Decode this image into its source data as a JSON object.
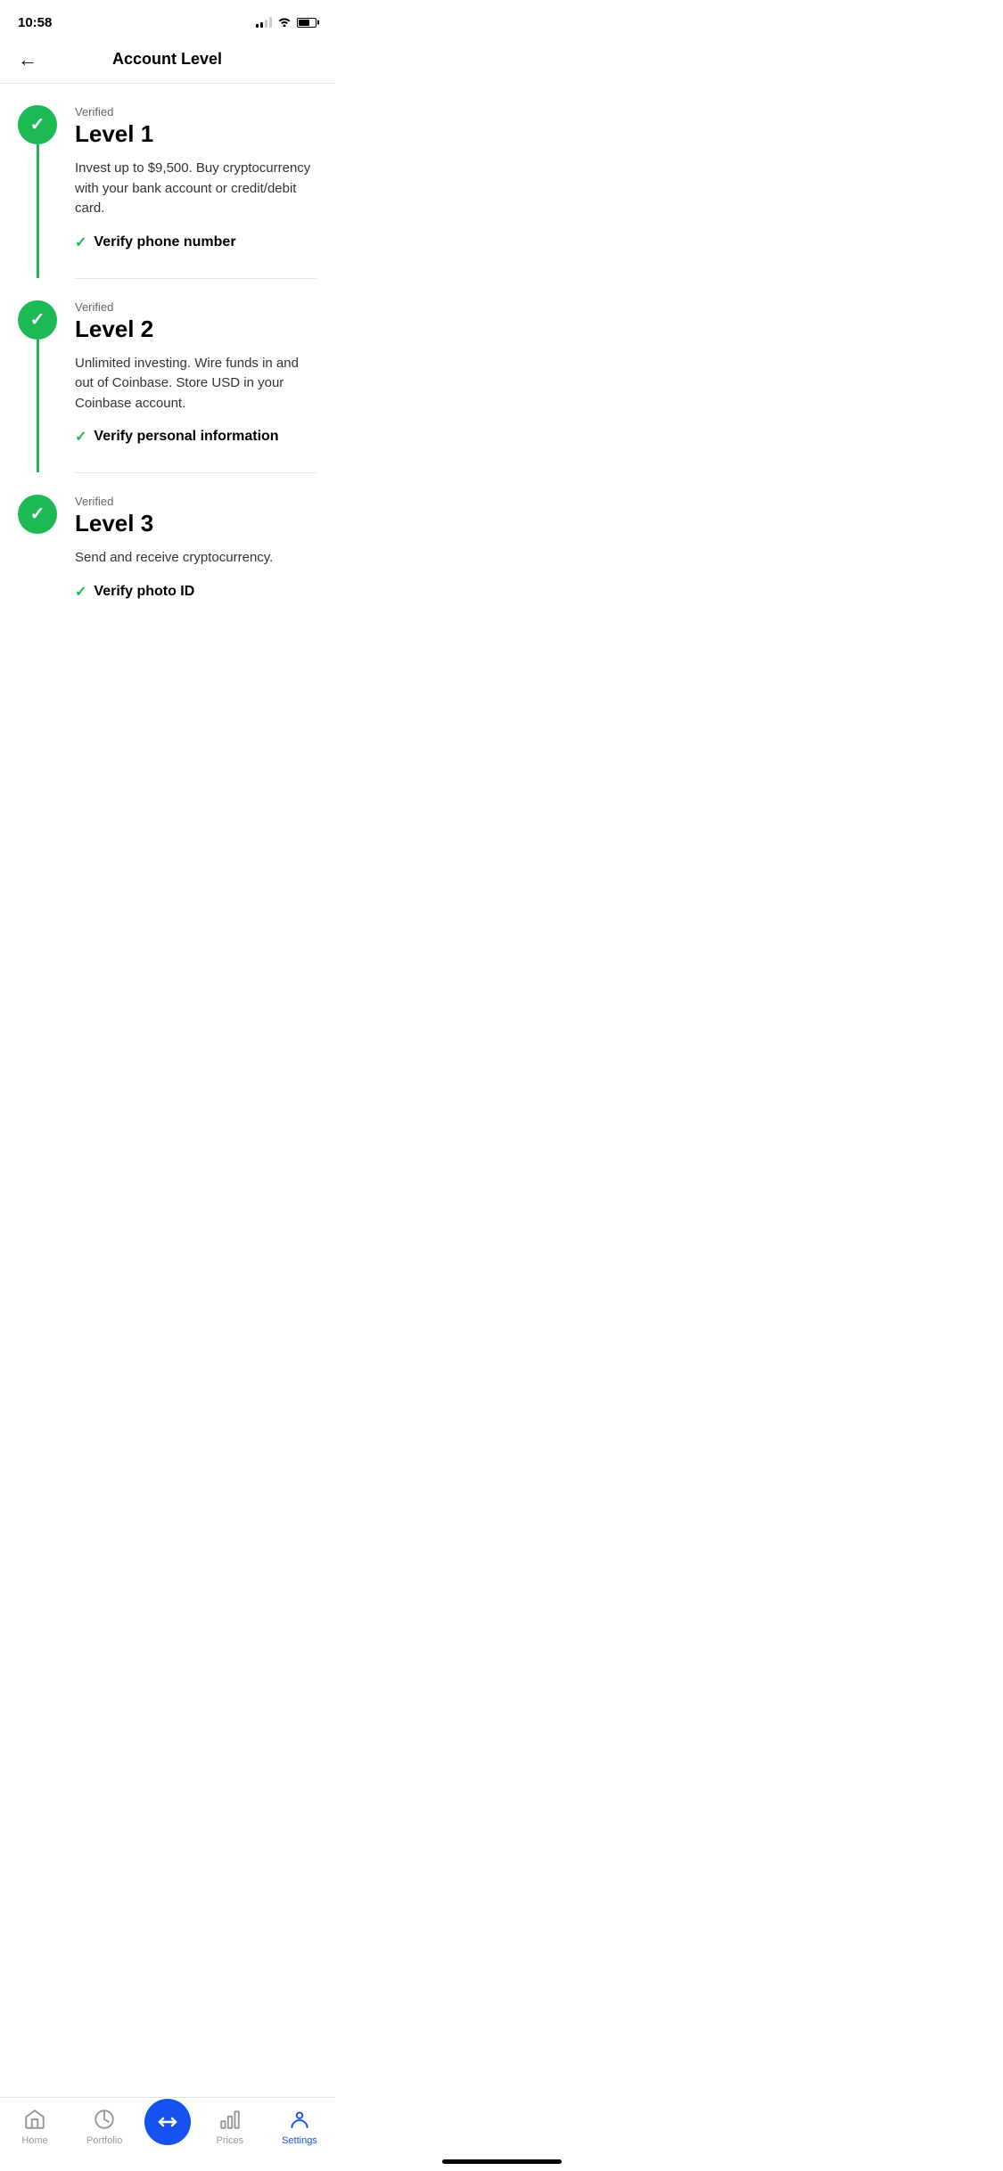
{
  "statusBar": {
    "time": "10:58",
    "hasLocation": true
  },
  "header": {
    "title": "Account Level",
    "backLabel": "←"
  },
  "levels": [
    {
      "id": "level1",
      "status": "Verified",
      "title": "Level 1",
      "description": "Invest up to $9,500. Buy cryptocurrency with your bank account or credit/debit card.",
      "verifyLabel": "Verify phone number",
      "verified": true
    },
    {
      "id": "level2",
      "status": "Verified",
      "title": "Level 2",
      "description": "Unlimited investing. Wire funds in and out of Coinbase. Store USD in your Coinbase account.",
      "verifyLabel": "Verify personal information",
      "verified": true
    },
    {
      "id": "level3",
      "status": "Verified",
      "title": "Level 3",
      "description": "Send and receive cryptocurrency.",
      "verifyLabel": "Verify photo ID",
      "verified": true
    }
  ],
  "tabBar": {
    "items": [
      {
        "id": "home",
        "label": "Home",
        "active": false
      },
      {
        "id": "portfolio",
        "label": "Portfolio",
        "active": false
      },
      {
        "id": "trade",
        "label": "",
        "active": false
      },
      {
        "id": "prices",
        "label": "Prices",
        "active": false
      },
      {
        "id": "settings",
        "label": "Settings",
        "active": true
      }
    ]
  }
}
